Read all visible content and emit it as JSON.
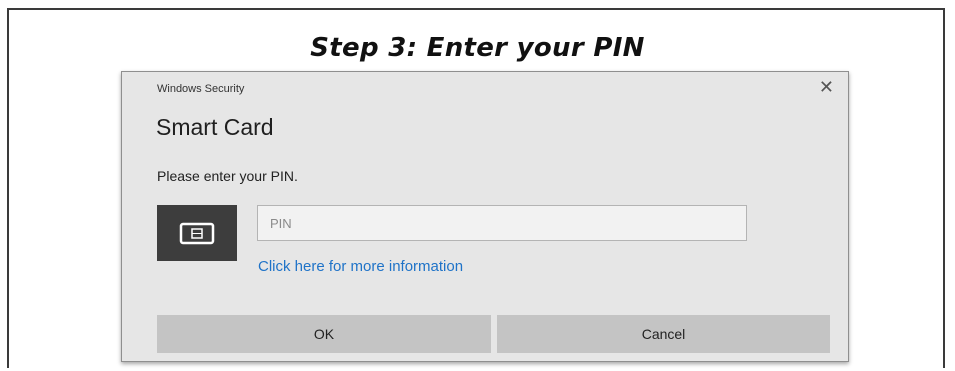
{
  "step_title": "Step 3: Enter your PIN",
  "dialog": {
    "caption": "Windows Security",
    "close_glyph": "✕",
    "heading": "Smart Card",
    "prompt": "Please enter your PIN.",
    "pin_placeholder": "PIN",
    "pin_value": "",
    "more_info_link": "Click here for more information",
    "ok_label": "OK",
    "cancel_label": "Cancel",
    "icon": "smart-card-icon"
  },
  "colors": {
    "dialog_bg": "#e6e6e6",
    "button_bg": "#c4c4c4",
    "icon_tile_bg": "#3d3d3d",
    "link": "#1f73c8"
  }
}
